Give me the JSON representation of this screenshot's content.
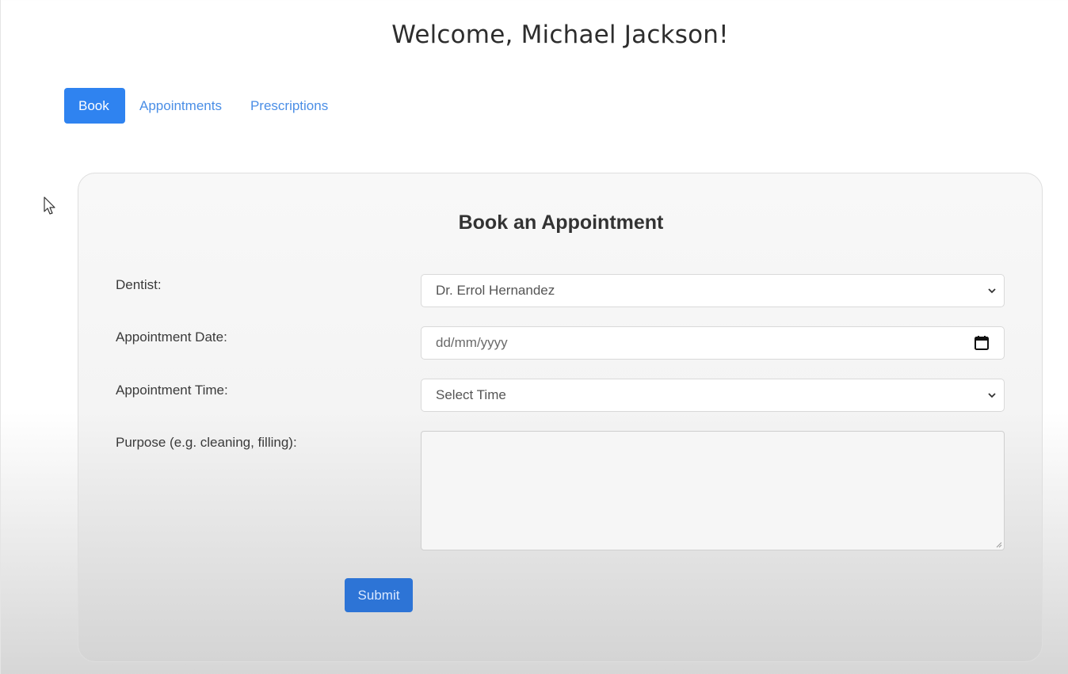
{
  "header": {
    "welcome": "Welcome, Michael Jackson!"
  },
  "tabs": [
    {
      "label": "Book",
      "active": true
    },
    {
      "label": "Appointments",
      "active": false
    },
    {
      "label": "Prescriptions",
      "active": false
    }
  ],
  "form": {
    "title": "Book an Appointment",
    "dentist": {
      "label": "Dentist:",
      "value": "Dr. Errol Hernandez"
    },
    "date": {
      "label": "Appointment Date:",
      "placeholder": "dd/mm/yyyy"
    },
    "time": {
      "label": "Appointment Time:",
      "value": "Select Time"
    },
    "purpose": {
      "label": "Purpose (e.g. cleaning, filling):",
      "value": ""
    },
    "submit_label": "Submit"
  },
  "colors": {
    "accent": "#2f83f0",
    "link": "#4a8ee6",
    "submit": "#2d74d6"
  },
  "icons": {
    "select_arrow": "chevron-down-icon",
    "date_picker": "calendar-icon",
    "pointer": "mouse-cursor-icon",
    "resize": "resize-handle-icon"
  }
}
